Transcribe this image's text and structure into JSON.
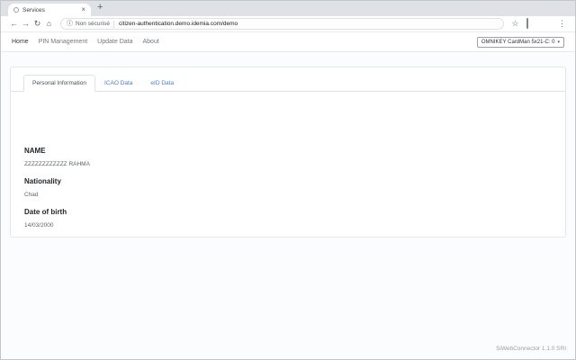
{
  "colors": {
    "chrome_strip": "#dee1e6",
    "accent_link": "#4a7dd3",
    "text_dark": "#212529",
    "text_gray": "#5f6368"
  },
  "browser": {
    "tab_title": "Services",
    "close_icon": "×",
    "new_tab_icon": "+",
    "back_icon": "←",
    "forward_icon": "→",
    "reload_icon": "↻",
    "home_icon": "⌂",
    "info_icon": "ⓘ",
    "security_label": "Non sécurisé",
    "url": "citizen-authentication.demo.idemia.com/demo",
    "star_icon": "☆",
    "menu_icon": "⋮"
  },
  "navbar": {
    "items": [
      {
        "label": "Home",
        "active": true
      },
      {
        "label": "PIN Management",
        "active": false
      },
      {
        "label": "Update Data",
        "active": false
      },
      {
        "label": "About",
        "active": false
      }
    ],
    "reader_select": {
      "value": "OMNIKEY CardMan 5x21-C: 0",
      "caret": "▾"
    }
  },
  "content": {
    "tabs": [
      {
        "label": "Personal Information",
        "active": true
      },
      {
        "label": "ICAO Data",
        "active": false
      },
      {
        "label": "eID Data",
        "active": false
      }
    ],
    "fields": [
      {
        "label": "NAME",
        "value": "ZZZZZZZZZZZZ RAHMA"
      },
      {
        "label": "Nationality",
        "value": "Chad"
      },
      {
        "label": "Date of birth",
        "value": "14/03/2000"
      }
    ]
  },
  "footer": {
    "text": "SiWebConnector 1.1.0 SRI"
  }
}
